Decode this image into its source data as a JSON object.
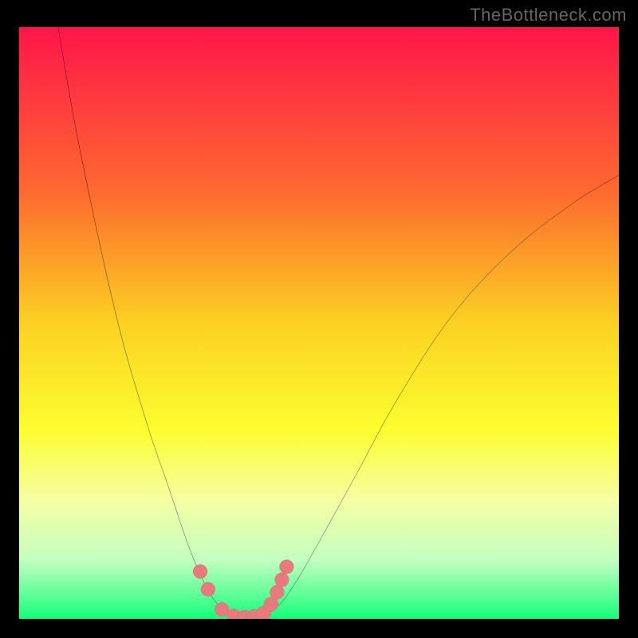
{
  "watermark": "TheBottleneck.com",
  "chart_data": {
    "type": "line",
    "title": "",
    "xlabel": "",
    "ylabel": "",
    "xlim": [
      0,
      100
    ],
    "ylim": [
      0,
      100
    ],
    "grid": false,
    "legend_position": "none",
    "gradient_stops": [
      {
        "offset": 0.0,
        "color": "#ff1549"
      },
      {
        "offset": 0.28,
        "color": "#fd6a2f"
      },
      {
        "offset": 0.5,
        "color": "#fbd123"
      },
      {
        "offset": 0.68,
        "color": "#fdfd2f"
      },
      {
        "offset": 0.8,
        "color": "#f5ffa3"
      },
      {
        "offset": 0.9,
        "color": "#c4ffc1"
      },
      {
        "offset": 0.97,
        "color": "#4bff90"
      },
      {
        "offset": 1.0,
        "color": "#12ff7a"
      }
    ],
    "series": [
      {
        "name": "left-branch",
        "type": "curve",
        "stroke": "#000000",
        "points": [
          {
            "x": 6.5,
            "y": 100.0
          },
          {
            "x": 10.0,
            "y": 80.0
          },
          {
            "x": 16.0,
            "y": 52.0
          },
          {
            "x": 21.0,
            "y": 34.0
          },
          {
            "x": 25.0,
            "y": 22.0
          },
          {
            "x": 28.0,
            "y": 13.0
          },
          {
            "x": 30.0,
            "y": 8.0
          },
          {
            "x": 32.0,
            "y": 4.0
          },
          {
            "x": 34.0,
            "y": 1.5
          },
          {
            "x": 36.0,
            "y": 0.3
          }
        ]
      },
      {
        "name": "right-branch",
        "type": "curve",
        "stroke": "#000000",
        "points": [
          {
            "x": 40.0,
            "y": 0.3
          },
          {
            "x": 43.0,
            "y": 2.0
          },
          {
            "x": 46.0,
            "y": 6.0
          },
          {
            "x": 50.0,
            "y": 13.0
          },
          {
            "x": 56.0,
            "y": 24.0
          },
          {
            "x": 63.0,
            "y": 37.0
          },
          {
            "x": 72.0,
            "y": 51.0
          },
          {
            "x": 82.0,
            "y": 62.0
          },
          {
            "x": 92.0,
            "y": 70.0
          },
          {
            "x": 100.0,
            "y": 75.0
          }
        ]
      },
      {
        "name": "baseline",
        "type": "line",
        "stroke": "#000000",
        "points": [
          {
            "x": 36.0,
            "y": 0.3
          },
          {
            "x": 40.0,
            "y": 0.3
          }
        ]
      }
    ],
    "markers": {
      "fill": "#e8797d",
      "stroke": "#b85256",
      "radius_pct": 1.2,
      "points": [
        {
          "x": 30.2,
          "y": 8.0
        },
        {
          "x": 31.5,
          "y": 5.0
        },
        {
          "x": 33.8,
          "y": 1.6
        },
        {
          "x": 35.8,
          "y": 0.5
        },
        {
          "x": 37.6,
          "y": 0.3
        },
        {
          "x": 39.2,
          "y": 0.4
        },
        {
          "x": 40.8,
          "y": 1.0
        },
        {
          "x": 42.0,
          "y": 2.5
        },
        {
          "x": 43.0,
          "y": 4.5
        },
        {
          "x": 43.8,
          "y": 6.6
        },
        {
          "x": 44.6,
          "y": 8.8
        }
      ]
    }
  }
}
